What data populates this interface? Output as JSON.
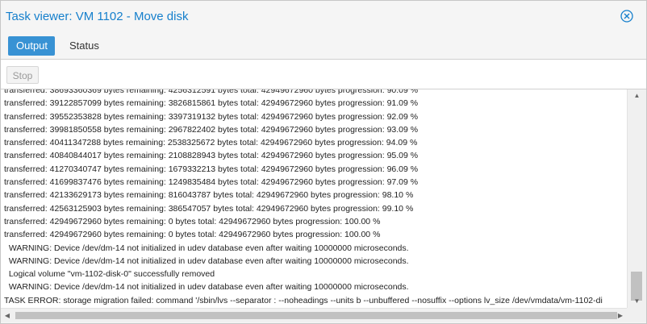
{
  "window": {
    "title": "Task viewer: VM 1102 - Move disk",
    "close_icon": "close-circle-icon",
    "accent_color": "#157fcc"
  },
  "tabs": [
    {
      "label": "Output",
      "active": true
    },
    {
      "label": "Status",
      "active": false
    }
  ],
  "toolbar": {
    "stop_label": "Stop",
    "stop_enabled": false
  },
  "log": {
    "lines": [
      "transferred: 38693360369 bytes remaining: 4256312591 bytes total: 42949672960 bytes progression: 90.09 %",
      "transferred: 39122857099 bytes remaining: 3826815861 bytes total: 42949672960 bytes progression: 91.09 %",
      "transferred: 39552353828 bytes remaining: 3397319132 bytes total: 42949672960 bytes progression: 92.09 %",
      "transferred: 39981850558 bytes remaining: 2967822402 bytes total: 42949672960 bytes progression: 93.09 %",
      "transferred: 40411347288 bytes remaining: 2538325672 bytes total: 42949672960 bytes progression: 94.09 %",
      "transferred: 40840844017 bytes remaining: 2108828943 bytes total: 42949672960 bytes progression: 95.09 %",
      "transferred: 41270340747 bytes remaining: 1679332213 bytes total: 42949672960 bytes progression: 96.09 %",
      "transferred: 41699837476 bytes remaining: 1249835484 bytes total: 42949672960 bytes progression: 97.09 %",
      "transferred: 42133629173 bytes remaining: 816043787 bytes total: 42949672960 bytes progression: 98.10 %",
      "transferred: 42563125903 bytes remaining: 386547057 bytes total: 42949672960 bytes progression: 99.10 %",
      "transferred: 42949672960 bytes remaining: 0 bytes total: 42949672960 bytes progression: 100.00 %",
      "transferred: 42949672960 bytes remaining: 0 bytes total: 42949672960 bytes progression: 100.00 %",
      "  WARNING: Device /dev/dm-14 not initialized in udev database even after waiting 10000000 microseconds.",
      "  WARNING: Device /dev/dm-14 not initialized in udev database even after waiting 10000000 microseconds.",
      "  Logical volume \"vm-1102-disk-0\" successfully removed",
      "  WARNING: Device /dev/dm-14 not initialized in udev database even after waiting 10000000 microseconds.",
      "TASK ERROR: storage migration failed: command '/sbin/lvs --separator : --noheadings --units b --unbuffered --nosuffix --options lv_size /dev/vmdata/vm-1102-di"
    ]
  },
  "scrollbars": {
    "vertical_position": 1.0,
    "horizontal_position": 0.0
  }
}
